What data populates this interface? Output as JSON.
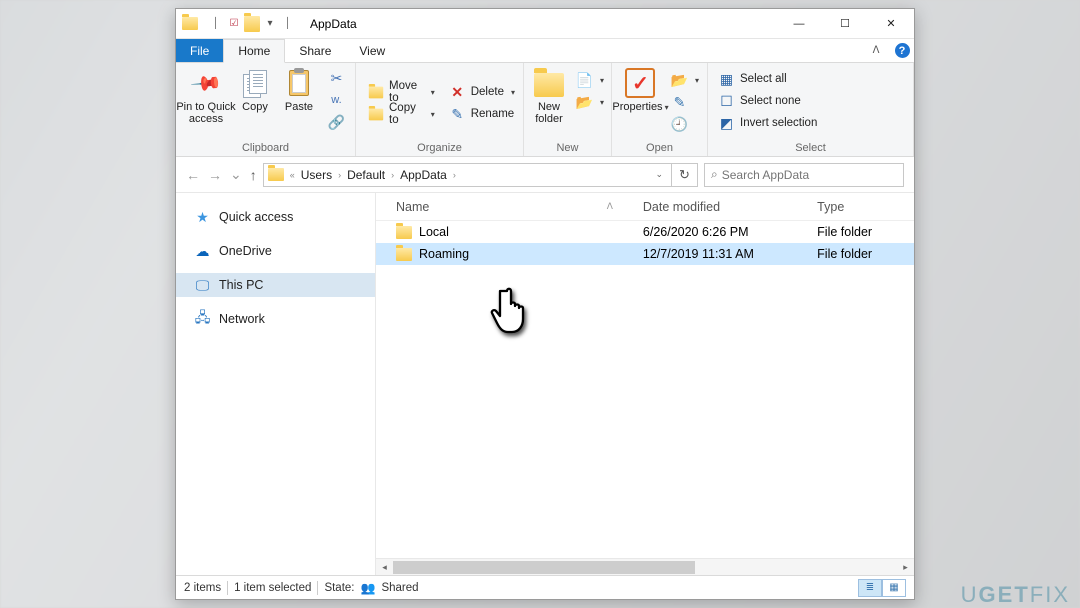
{
  "watermark": {
    "prefix": "U",
    "mid": "GET",
    "suffix": "FIX"
  },
  "window": {
    "title": "AppData"
  },
  "qat": {
    "save": "▾",
    "undo": "✓",
    "down": "▾"
  },
  "win_controls": {
    "min": "—",
    "max": "☐",
    "close": "✕"
  },
  "menubar": {
    "file": "File",
    "home": "Home",
    "share": "Share",
    "view": "View",
    "collapse": "ᐱ"
  },
  "ribbon": {
    "clipboard": {
      "label": "Clipboard",
      "pin": "Pin to Quick\naccess",
      "copy": "Copy",
      "paste": "Paste",
      "cut": " ",
      "copy_path": " ",
      "paste_shortcut": " "
    },
    "organize": {
      "label": "Organize",
      "move_to": "Move to",
      "copy_to": "Copy to",
      "delete": "Delete",
      "rename": "Rename"
    },
    "new": {
      "label": "New",
      "new_folder": "New\nfolder",
      "new_item": " ",
      "easy_access": " "
    },
    "open": {
      "label": "Open",
      "properties": "Properties",
      "open": " ",
      "edit": " ",
      "history": " "
    },
    "select": {
      "label": "Select",
      "select_all": "Select all",
      "select_none": "Select none",
      "invert": "Invert selection"
    }
  },
  "address": {
    "back": "←",
    "fwd": "→",
    "recent": "⌄",
    "up": "↑",
    "sep": "›",
    "root_sep": "«",
    "parts": [
      "Users",
      "Default",
      "AppData"
    ],
    "refresh": "↻"
  },
  "search": {
    "placeholder": "Search AppData",
    "icon": "⌕"
  },
  "sidebar": {
    "items": [
      {
        "icon": "★",
        "label": "Quick access",
        "cls": "star-ico"
      },
      {
        "icon": "☁",
        "label": "OneDrive",
        "cls": "cloud-ico"
      },
      {
        "icon": "🖵",
        "label": "This PC",
        "cls": "monitor-ico",
        "selected": true
      },
      {
        "icon": "🖧",
        "label": "Network",
        "cls": "network-ico"
      }
    ]
  },
  "columns": {
    "name": "Name",
    "date": "Date modified",
    "type": "Type",
    "sort": "ᐱ"
  },
  "files": [
    {
      "name": "Local",
      "date": "6/26/2020 6:26 PM",
      "type": "File folder",
      "selected": false
    },
    {
      "name": "Roaming",
      "date": "12/7/2019 11:31 AM",
      "type": "File folder",
      "selected": true
    }
  ],
  "status": {
    "count": "2 items",
    "selected": "1 item selected",
    "state_label": "State:",
    "state_value": "Shared",
    "shared_icon": "👥"
  },
  "view_toggle": {
    "details": "≣",
    "tiles": "▦"
  }
}
